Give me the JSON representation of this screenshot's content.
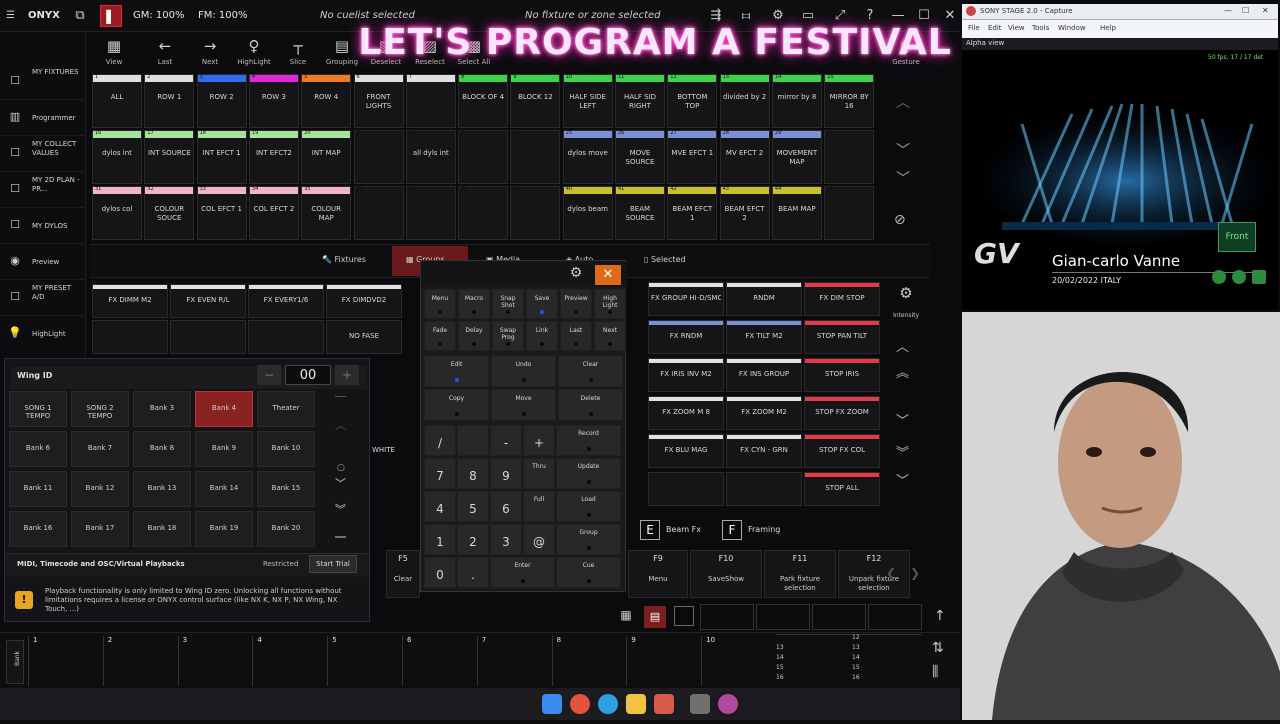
{
  "topbar": {
    "app": "ONYX",
    "gm": "GM: 100%",
    "fm": "FM: 100%",
    "cuelist": "No cuelist selected",
    "fixture": "No fixture or zone selected"
  },
  "sidebar": [
    {
      "label": "MY FIXTURES",
      "icon": "checkbox-icon"
    },
    {
      "label": "Programmer",
      "icon": "programmer-icon"
    },
    {
      "label": "MY COLLECT VALUES",
      "icon": "checkbox-icon"
    },
    {
      "label": "MY 2D PLAN -PR...",
      "icon": "checkbox-icon"
    },
    {
      "label": "MY DYLOS",
      "icon": "checkbox-icon"
    },
    {
      "label": "Preview",
      "icon": "eye-icon"
    },
    {
      "label": "MY PRESET A/D",
      "icon": "checkbox-icon"
    },
    {
      "label": "HighLight",
      "icon": "bulb-icon"
    }
  ],
  "toolbar": [
    "View",
    "Last",
    "Next",
    "HighLight",
    "Slice",
    "Grouping",
    "Deselect",
    "Reselect",
    "Select All"
  ],
  "gesture_label": "Gesture",
  "overlay_title": "LET'S PROGRAM A FESTIVAL",
  "grid_rows": [
    [
      {
        "n": "1",
        "label": "ALL",
        "color": "#e0e0e0"
      },
      {
        "n": "2",
        "label": "ROW 1",
        "color": "#e0e0e0"
      },
      {
        "n": "3",
        "label": "ROW 2",
        "color": "#2f6df0"
      },
      {
        "n": "4",
        "label": "ROW 3",
        "color": "#e02ad8"
      },
      {
        "n": "5",
        "label": "ROW 4",
        "color": "#f07a20"
      },
      {
        "n": "6",
        "label": "FRONT LIGHTS",
        "color": "#e0e0e0"
      },
      {
        "n": "7",
        "label": "",
        "color": "#e0e0e0"
      },
      {
        "n": "8",
        "label": "BLOCK OF 4",
        "color": "#3ad34a"
      },
      {
        "n": "9",
        "label": "BLOCK 12",
        "color": "#3ad34a"
      },
      {
        "n": "10",
        "label": "HALF SIDE LEFT",
        "color": "#3ad34a"
      },
      {
        "n": "11",
        "label": "HALF SID RIGHT",
        "color": "#3ad34a"
      },
      {
        "n": "12",
        "label": "BOTTOM TOP",
        "color": "#3ad34a"
      },
      {
        "n": "13",
        "label": "divided by 2",
        "color": "#3ad34a"
      },
      {
        "n": "14",
        "label": "mirror by 8",
        "color": "#3ad34a"
      },
      {
        "n": "15",
        "label": "MIRROR BY 16",
        "color": "#3ad34a"
      }
    ],
    [
      {
        "n": "16",
        "label": "dylos int",
        "color": "#a6e39a"
      },
      {
        "n": "17",
        "label": "INT SOURCE",
        "color": "#a6e39a"
      },
      {
        "n": "18",
        "label": "INT EFCT 1",
        "color": "#a6e39a"
      },
      {
        "n": "19",
        "label": "INT EFCT2",
        "color": "#a6e39a"
      },
      {
        "n": "20",
        "label": "INT MAP",
        "color": "#a6e39a"
      },
      {
        "n": "21",
        "label": "",
        "color": ""
      },
      {
        "n": "22",
        "label": "all dyls int",
        "color": ""
      },
      {
        "n": "23",
        "label": "",
        "color": ""
      },
      {
        "n": "24",
        "label": "",
        "color": ""
      },
      {
        "n": "25",
        "label": "dylos move",
        "color": "#7b8fd6"
      },
      {
        "n": "26",
        "label": "MOVE SOURCE",
        "color": "#7b8fd6"
      },
      {
        "n": "27",
        "label": "MVE EFCT 1",
        "color": "#7b8fd6"
      },
      {
        "n": "28",
        "label": "MV EFCT 2",
        "color": "#7b8fd6"
      },
      {
        "n": "29",
        "label": "MOVEMENT MAP",
        "color": "#7b8fd6"
      },
      {
        "n": "30",
        "label": "",
        "color": ""
      }
    ],
    [
      {
        "n": "31",
        "label": "dylos col",
        "color": "#f1b3c6"
      },
      {
        "n": "32",
        "label": "COLOUR SOUCE",
        "color": "#f1b3c6"
      },
      {
        "n": "33",
        "label": "COL EFCT 1",
        "color": "#f1b3c6"
      },
      {
        "n": "34",
        "label": "COL EFCT 2",
        "color": "#f1b3c6"
      },
      {
        "n": "35",
        "label": "COLOUR MAP",
        "color": "#f1b3c6"
      },
      {
        "n": "36",
        "label": "",
        "color": ""
      },
      {
        "n": "37",
        "label": "",
        "color": ""
      },
      {
        "n": "38",
        "label": "",
        "color": ""
      },
      {
        "n": "39",
        "label": "",
        "color": ""
      },
      {
        "n": "40",
        "label": "dylos beam",
        "color": "#c9c12a"
      },
      {
        "n": "41",
        "label": "BEAM SOURCE",
        "color": "#c9c12a"
      },
      {
        "n": "42",
        "label": "BEAM EFCT 1",
        "color": "#c9c12a"
      },
      {
        "n": "43",
        "label": "BEAM EFCT 2",
        "color": "#c9c12a"
      },
      {
        "n": "44",
        "label": "BEAM MAP",
        "color": "#c9c12a"
      },
      {
        "n": "45",
        "label": "",
        "color": ""
      }
    ]
  ],
  "view_tabs": [
    "Fixtures",
    "Groups",
    "Media",
    "Auto",
    "Selected"
  ],
  "presets_left": [
    {
      "label": "FX DIMM M2",
      "color": "#e0e0e0"
    },
    {
      "label": "FX EVEN R/L",
      "color": "#e0e0e0"
    },
    {
      "label": "FX EVERY1/6",
      "color": "#e0e0e0"
    },
    {
      "label": "FX DIMDVD2",
      "color": "#e0e0e0"
    },
    {
      "label": "NO FASE",
      "color": ""
    }
  ],
  "presets_right": [
    {
      "label": "FX GROUP HI-D/SMOOTH",
      "color": "#e0e0e0"
    },
    {
      "label": "RNDM",
      "color": "#e0e0e0"
    },
    {
      "label": "FX DIM STOP",
      "color": "#e23a48"
    },
    {
      "label": "FX RNDM",
      "color": "#7b8fd6"
    },
    {
      "label": "FX TILT M2",
      "color": "#7b8fd6"
    },
    {
      "label": "STOP PAN TILT",
      "color": "#e23a48"
    },
    {
      "label": "FX IRIS INV M2",
      "color": "#e0e0e0"
    },
    {
      "label": "FX INS GROUP",
      "color": "#e0e0e0"
    },
    {
      "label": "STOP IRIS",
      "color": "#e23a48"
    },
    {
      "label": "FX ZOOM M 8",
      "color": "#e0e0e0"
    },
    {
      "label": "FX ZOOM M2",
      "color": "#e0e0e0"
    },
    {
      "label": "STOP FX ZOOM",
      "color": "#e23a48"
    },
    {
      "label": "FX BLU MAG",
      "color": "#e0e0e0"
    },
    {
      "label": "FX CYN - GRN",
      "color": "#e0e0e0"
    },
    {
      "label": "STOP FX COL",
      "color": "#e23a48"
    },
    {
      "label": "",
      "color": ""
    },
    {
      "label": "",
      "color": ""
    },
    {
      "label": "STOP ALL",
      "color": "#e23a48"
    }
  ],
  "white_label": "WHITE",
  "intensity_label": "Intensity",
  "wing": {
    "title": "Wing ID",
    "value": "00",
    "banks": [
      "SONG 1 TEMPO",
      "SONG 2 TEMPO",
      "Bank 3",
      "Bank 4",
      "Theater",
      "Bank 6",
      "Bank 7",
      "Bank 8",
      "Bank 9",
      "Bank 10",
      "Bank 11",
      "Bank 12",
      "Bank 13",
      "Bank 14",
      "Bank 15",
      "Bank 16",
      "Bank 17",
      "Bank 18",
      "Bank 19",
      "Bank 20"
    ],
    "midi": "MIDI, Timecode and OSC/Virtual Playbacks",
    "restricted": "Restricted",
    "start_trial": "Start Trial",
    "warning": "Playback functionality is only limited to Wing ID zero. Unlocking all functions without limitations requires a license or ONYX control surface (like NX K, NX P, NX Wing, NX Touch, ...)"
  },
  "keypad": {
    "fn": [
      "Menu",
      "Macro",
      "Snap Shot",
      "Save",
      "Preview",
      "High Light",
      "Fade",
      "Delay",
      "Swap Prog",
      "Link",
      "Last",
      "Next"
    ],
    "edit": [
      "Edit",
      "Undo",
      "Clear",
      "Copy",
      "Move",
      "Delete"
    ],
    "keys": [
      "/",
      "-",
      "+",
      "Record",
      "7",
      "8",
      "9",
      "Thru",
      "Update",
      "4",
      "5",
      "6",
      "Full",
      "Load",
      "1",
      "2",
      "3",
      "@",
      "Group",
      "0",
      ".",
      "Enter",
      "Cue"
    ]
  },
  "fxtabs": [
    "Beam Fx",
    "Framing"
  ],
  "fkeys": [
    {
      "f": "F5",
      "d": "Clear"
    },
    {
      "f": "F9",
      "d": "Menu"
    },
    {
      "f": "F10",
      "d": "SaveShow"
    },
    {
      "f": "F11",
      "d": "Park fixture selection"
    },
    {
      "f": "F12",
      "d": "Unpark fixture selection"
    }
  ],
  "faders": [
    "1",
    "2",
    "3",
    "4",
    "5",
    "6",
    "7",
    "8",
    "9",
    "10"
  ],
  "bank_label": "Bank",
  "mini_numbers": [
    "12",
    "13",
    "14",
    "15",
    "16"
  ],
  "capture": {
    "title": "SONY STAGE 2.0 - Capture",
    "menu": [
      "File",
      "Edit",
      "View",
      "Tools",
      "Window",
      "Help"
    ],
    "view": "Alpha view",
    "fps": "50 fps, 17 / 17 det",
    "front": "Front",
    "name": "Gian-carlo Vanne",
    "date": "20/02/2022 ITALY"
  }
}
